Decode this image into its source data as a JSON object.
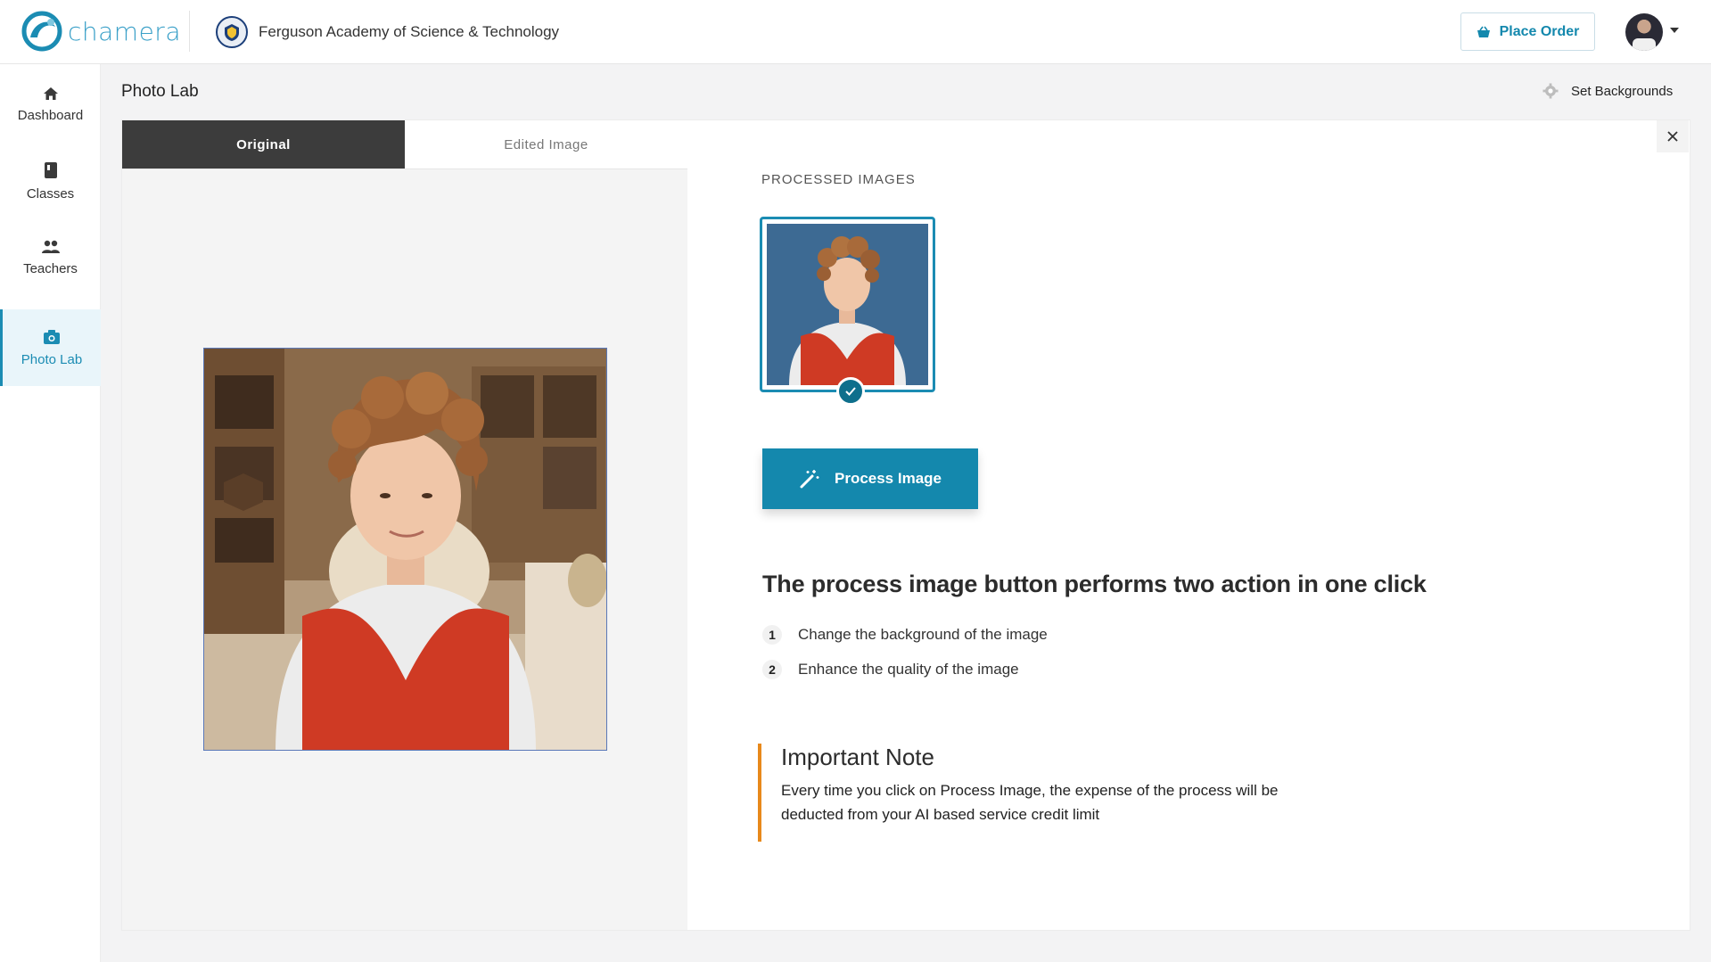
{
  "header": {
    "brand": "chamera",
    "school_name": "Ferguson Academy of Science & Technology",
    "place_order_label": "Place Order",
    "brand_color": "#1488ad"
  },
  "sidebar": {
    "items": [
      {
        "label": "Dashboard",
        "icon": "home-icon",
        "active": false
      },
      {
        "label": "Classes",
        "icon": "book-icon",
        "active": false
      },
      {
        "label": "Teachers",
        "icon": "people-icon",
        "active": false
      },
      {
        "label": "Photo Lab",
        "icon": "camera-icon",
        "active": true
      }
    ]
  },
  "page": {
    "title": "Photo Lab",
    "set_backgrounds_label": "Set Backgrounds"
  },
  "tabs": [
    {
      "label": "Original",
      "active": true
    },
    {
      "label": "Edited Image",
      "active": false
    }
  ],
  "processed": {
    "section_label": "PROCESSED IMAGES",
    "process_button_label": "Process Image"
  },
  "info": {
    "heading": "The process image button performs two action in one click",
    "steps": [
      {
        "num": "1",
        "text": "Change the background of the image"
      },
      {
        "num": "2",
        "text": "Enhance the quality of the image"
      }
    ]
  },
  "note": {
    "title": "Important Note",
    "body": "Every time you click on Process Image, the expense of the process will be deducted from your AI based service credit limit",
    "accent": "#e8891b"
  }
}
